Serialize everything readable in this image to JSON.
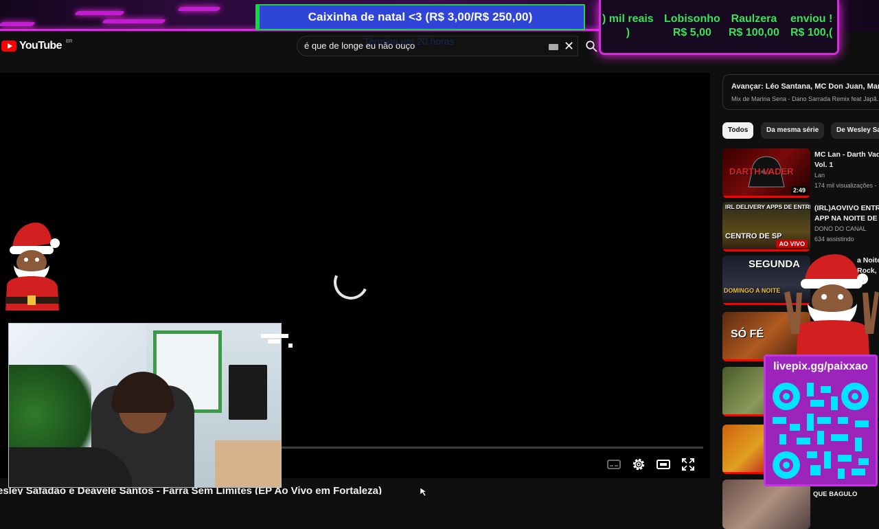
{
  "stream_overlay": {
    "goal_text": "Caixinha de natal <3 (R$ 3,00/R$ 250,00)",
    "donations": [
      {
        "name": ") mil reais",
        "amount": ")"
      },
      {
        "name": "Lobisonho",
        "amount": "R$ 5,00"
      },
      {
        "name": "Raulzera",
        "amount": "R$ 100,00"
      },
      {
        "name": "enviou !",
        "amount": "R$ 100,("
      }
    ],
    "ghost_text": "Termina em 20 horas",
    "qr_label": "livepix.gg/paixxao",
    "colors": {
      "neon": "#d52cdf",
      "goal_bar": "#2f45d8",
      "donation_green": "#39e356",
      "qr_bg": "#9c24bc"
    }
  },
  "header": {
    "logo_text": "YouTube",
    "country_code": "BR",
    "search_value": "é que de longe eu não ouço"
  },
  "player": {
    "video_title": "esley Safadão e Deavele Santos - Farra Sem Limites (EP Ao Vivo em Fortaleza)"
  },
  "sidebar": {
    "autoplay": {
      "label": "Avançar: Léo Santana, MC Don Juan, Mari Fe...",
      "subtitle": "Mix de Marina Sena - Dano Sarrada Remix feat Japã..."
    },
    "chips": [
      {
        "label": "Todos",
        "active": true
      },
      {
        "label": "Da mesma série",
        "active": false
      },
      {
        "label": "De Wesley Sa",
        "active": false
      }
    ],
    "recommendations": [
      {
        "title1": "MC Lan - Darth Vade",
        "title2": "Vol. 1",
        "channel": "Lan",
        "meta": "174 mil visualizações -",
        "duration": "2:49",
        "thumb_text": "DARTH VADER"
      },
      {
        "title1": "(IRL)AOVIVO ENTRE",
        "title2": "APP NA NOITE DE S",
        "channel": "DONO DO CANAL",
        "meta": "634 assistindo",
        "badge": "AO VIVO",
        "thumb_text_top": "IRL DELIVERY APPS DE ENTREGA",
        "thumb_text_bottom": "CENTRO DE SP"
      },
      {
        "title1": "a Noite",
        "title2": "Rock, I",
        "thumb_text_top": "SEGUNDA",
        "thumb_text_bottom": "DOMINGO A NOITE"
      },
      {
        "thumb_text": "SÓ FÉ"
      },
      {},
      {},
      {
        "title1": "QUE BAGULO"
      }
    ]
  }
}
